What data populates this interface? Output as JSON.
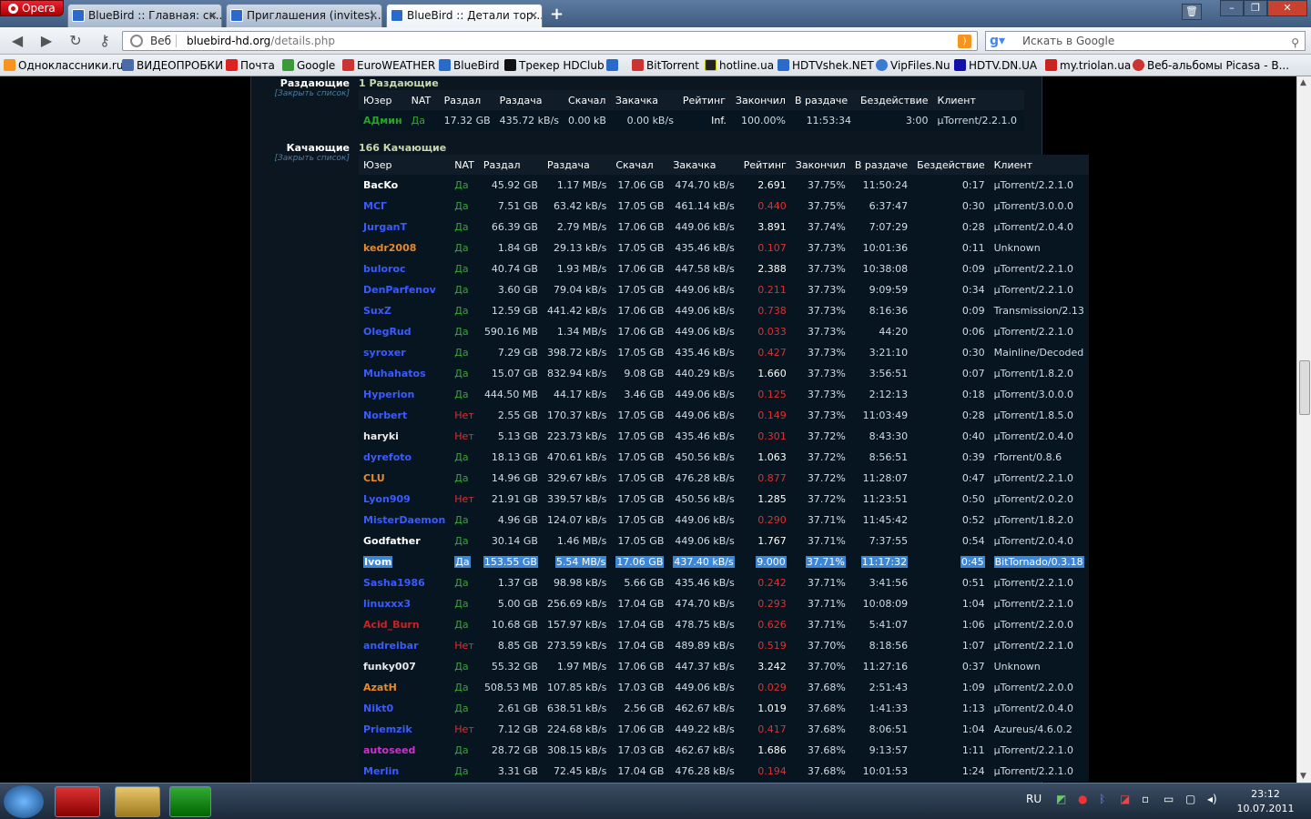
{
  "browser": {
    "menu_label": "Opera",
    "tabs": [
      {
        "title": "BlueBird :: Главная: ск...",
        "active": false
      },
      {
        "title": "Приглашения (invites)...",
        "active": false
      },
      {
        "title": "BlueBird :: Детали тор...",
        "active": true
      }
    ],
    "address": {
      "mode": "Веб",
      "host": "bluebird-hd.org",
      "path": "/details.php"
    },
    "search_placeholder": "Искать в Google",
    "bookmarks": [
      "Одноклассники.ru",
      "ВИДЕОПРОБКИ",
      "Почта",
      "Google",
      "EuroWEATHER",
      "BlueBird",
      "Трекер HDClub",
      "BitTorrent",
      "hotline.ua",
      "HDTVshek.NET",
      "VipFiles.Nu",
      "HDTV.DN.UA",
      "my.triolan.ua",
      "Веб-альбомы Picasa - B..."
    ]
  },
  "seeders": {
    "label": "Раздающие",
    "close": "[Закрыть список]",
    "count_text": "1 Раздающие",
    "headers": [
      "Юзер",
      "NAT",
      "Раздал",
      "Раздача",
      "Скачал",
      "Закачка",
      "Рейтинг",
      "Закончил",
      "В раздаче",
      "Бездействие",
      "Клиент"
    ],
    "rows": [
      [
        "АДмин",
        "Да",
        "17.32 GB",
        "435.72 kB/s",
        "0.00 kB",
        "0.00 kB/s",
        "Inf.",
        "100.00%",
        "11:53:34",
        "3:00",
        "µTorrent/2.2.1.0"
      ]
    ]
  },
  "leechers": {
    "label": "Качающие",
    "close": "[Закрыть список]",
    "count_text": "166 Качающие",
    "headers": [
      "Юзер",
      "NAT",
      "Раздал",
      "Раздача",
      "Скачал",
      "Закачка",
      "Рейтинг",
      "Закончил",
      "В раздаче",
      "Бездействие",
      "Клиент"
    ],
    "rows": [
      [
        "BacKo",
        "Да",
        "45.92 GB",
        "1.17 MB/s",
        "17.06 GB",
        "474.70 kB/s",
        "2.691",
        "37.75%",
        "11:50:24",
        "0:17",
        "µTorrent/2.2.1.0"
      ],
      [
        "MCГ",
        "Да",
        "7.51 GB",
        "63.42 kB/s",
        "17.05 GB",
        "461.14 kB/s",
        "0.440",
        "37.75%",
        "6:37:47",
        "0:30",
        "µTorrent/3.0.0.0"
      ],
      [
        "JurganT",
        "Да",
        "66.39 GB",
        "2.79 MB/s",
        "17.06 GB",
        "449.06 kB/s",
        "3.891",
        "37.74%",
        "7:07:29",
        "0:28",
        "µTorrent/2.0.4.0"
      ],
      [
        "kedr2008",
        "Да",
        "1.84 GB",
        "29.13 kB/s",
        "17.05 GB",
        "435.46 kB/s",
        "0.107",
        "37.73%",
        "10:01:36",
        "0:11",
        "Unknown"
      ],
      [
        "buloroc",
        "Да",
        "40.74 GB",
        "1.93 MB/s",
        "17.06 GB",
        "447.58 kB/s",
        "2.388",
        "37.73%",
        "10:38:08",
        "0:09",
        "µTorrent/2.2.1.0"
      ],
      [
        "DenParfenov",
        "Да",
        "3.60 GB",
        "79.04 kB/s",
        "17.05 GB",
        "449.06 kB/s",
        "0.211",
        "37.73%",
        "9:09:59",
        "0:34",
        "µTorrent/2.2.1.0"
      ],
      [
        "SuxZ",
        "Да",
        "12.59 GB",
        "441.42 kB/s",
        "17.06 GB",
        "449.06 kB/s",
        "0.738",
        "37.73%",
        "8:16:36",
        "0:09",
        "Transmission/2.13"
      ],
      [
        "OlegRud",
        "Да",
        "590.16 MB",
        "1.34 MB/s",
        "17.06 GB",
        "449.06 kB/s",
        "0.033",
        "37.73%",
        "44:20",
        "0:06",
        "µTorrent/2.2.1.0"
      ],
      [
        "syroxer",
        "Да",
        "7.29 GB",
        "398.72 kB/s",
        "17.05 GB",
        "435.46 kB/s",
        "0.427",
        "37.73%",
        "3:21:10",
        "0:30",
        "Mainline/Decoded"
      ],
      [
        "Muhahatos",
        "Да",
        "15.07 GB",
        "832.94 kB/s",
        "9.08 GB",
        "440.29 kB/s",
        "1.660",
        "37.73%",
        "3:56:51",
        "0:07",
        "µTorrent/1.8.2.0"
      ],
      [
        "Hyperion",
        "Да",
        "444.50 MB",
        "44.17 kB/s",
        "3.46 GB",
        "449.06 kB/s",
        "0.125",
        "37.73%",
        "2:12:13",
        "0:18",
        "µTorrent/3.0.0.0"
      ],
      [
        "Norbert",
        "Нет",
        "2.55 GB",
        "170.37 kB/s",
        "17.05 GB",
        "449.06 kB/s",
        "0.149",
        "37.73%",
        "11:03:49",
        "0:28",
        "µTorrent/1.8.5.0"
      ],
      [
        "haryki",
        "Нет",
        "5.13 GB",
        "223.73 kB/s",
        "17.05 GB",
        "435.46 kB/s",
        "0.301",
        "37.72%",
        "8:43:30",
        "0:40",
        "µTorrent/2.0.4.0"
      ],
      [
        "dyrefoto",
        "Да",
        "18.13 GB",
        "470.61 kB/s",
        "17.05 GB",
        "450.56 kB/s",
        "1.063",
        "37.72%",
        "8:56:51",
        "0:39",
        "rTorrent/0.8.6"
      ],
      [
        "CLU",
        "Да",
        "14.96 GB",
        "329.67 kB/s",
        "17.05 GB",
        "476.28 kB/s",
        "0.877",
        "37.72%",
        "11:28:07",
        "0:47",
        "µTorrent/2.2.1.0"
      ],
      [
        "Lyon909",
        "Нет",
        "21.91 GB",
        "339.57 kB/s",
        "17.05 GB",
        "450.56 kB/s",
        "1.285",
        "37.72%",
        "11:23:51",
        "0:50",
        "µTorrent/2.0.2.0"
      ],
      [
        "MisterDaemon",
        "Да",
        "4.96 GB",
        "124.07 kB/s",
        "17.05 GB",
        "449.06 kB/s",
        "0.290",
        "37.71%",
        "11:45:42",
        "0:52",
        "µTorrent/1.8.2.0"
      ],
      [
        "Godfather",
        "Да",
        "30.14 GB",
        "1.46 MB/s",
        "17.05 GB",
        "449.06 kB/s",
        "1.767",
        "37.71%",
        "7:37:55",
        "0:54",
        "µTorrent/2.0.4.0"
      ],
      [
        "Ivom",
        "Да",
        "153.55 GB",
        "5.54 MB/s",
        "17.06 GB",
        "437.40 kB/s",
        "9.000",
        "37.71%",
        "11:17:32",
        "0:45",
        "BitTornado/0.3.18"
      ],
      [
        "Sasha1986",
        "Да",
        "1.37 GB",
        "98.98 kB/s",
        "5.66 GB",
        "435.46 kB/s",
        "0.242",
        "37.71%",
        "3:41:56",
        "0:51",
        "µTorrent/2.2.1.0"
      ],
      [
        "linuxxx3",
        "Да",
        "5.00 GB",
        "256.69 kB/s",
        "17.04 GB",
        "474.70 kB/s",
        "0.293",
        "37.71%",
        "10:08:09",
        "1:04",
        "µTorrent/2.2.1.0"
      ],
      [
        "Acid_Burn",
        "Да",
        "10.68 GB",
        "157.97 kB/s",
        "17.04 GB",
        "478.75 kB/s",
        "0.626",
        "37.71%",
        "5:41:07",
        "1:06",
        "µTorrent/2.2.0.0"
      ],
      [
        "andreibar",
        "Нет",
        "8.85 GB",
        "273.59 kB/s",
        "17.04 GB",
        "489.89 kB/s",
        "0.519",
        "37.70%",
        "8:18:56",
        "1:07",
        "µTorrent/2.2.1.0"
      ],
      [
        "funky007",
        "Да",
        "55.32 GB",
        "1.97 MB/s",
        "17.06 GB",
        "447.37 kB/s",
        "3.242",
        "37.70%",
        "11:27:16",
        "0:37",
        "Unknown"
      ],
      [
        "AzatH",
        "Да",
        "508.53 MB",
        "107.85 kB/s",
        "17.03 GB",
        "449.06 kB/s",
        "0.029",
        "37.68%",
        "2:51:43",
        "1:09",
        "µTorrent/2.2.0.0"
      ],
      [
        "Nikt0",
        "Да",
        "2.61 GB",
        "638.51 kB/s",
        "2.56 GB",
        "462.67 kB/s",
        "1.019",
        "37.68%",
        "1:41:33",
        "1:13",
        "µTorrent/2.0.4.0"
      ],
      [
        "Priemzik",
        "Нет",
        "7.12 GB",
        "224.68 kB/s",
        "17.06 GB",
        "449.22 kB/s",
        "0.417",
        "37.68%",
        "8:06:51",
        "1:04",
        "Azureus/4.6.0.2"
      ],
      [
        "autoseed",
        "Да",
        "28.72 GB",
        "308.15 kB/s",
        "17.03 GB",
        "462.67 kB/s",
        "1.686",
        "37.68%",
        "9:13:57",
        "1:11",
        "µTorrent/2.2.1.0"
      ],
      [
        "Merlin",
        "Да",
        "3.31 GB",
        "72.45 kB/s",
        "17.04 GB",
        "476.28 kB/s",
        "0.194",
        "37.68%",
        "10:01:53",
        "1:24",
        "µTorrent/2.2.1.0"
      ]
    ],
    "selected_index": 18,
    "user_colors": [
      "#ffffff",
      "#3a5bff",
      "#3a5bff",
      "#e88a2a",
      "#3a5bff",
      "#3a5bff",
      "#3a5bff",
      "#3a5bff",
      "#3a5bff",
      "#3a5bff",
      "#3a5bff",
      "#3a5bff",
      "#e8e8e8",
      "#3a5bff",
      "#e88a2a",
      "#3a5bff",
      "#3a5bff",
      "#ffffff",
      "#ffffff",
      "#3a5bff",
      "#3a5bff",
      "#cc2222",
      "#3a5bff",
      "#e8e8e8",
      "#e88a2a",
      "#3a5bff",
      "#3a5bff",
      "#cc33cc",
      "#3a5bff"
    ]
  },
  "taskbar": {
    "lang": "RU",
    "time": "23:12",
    "date": "10.07.2011"
  }
}
